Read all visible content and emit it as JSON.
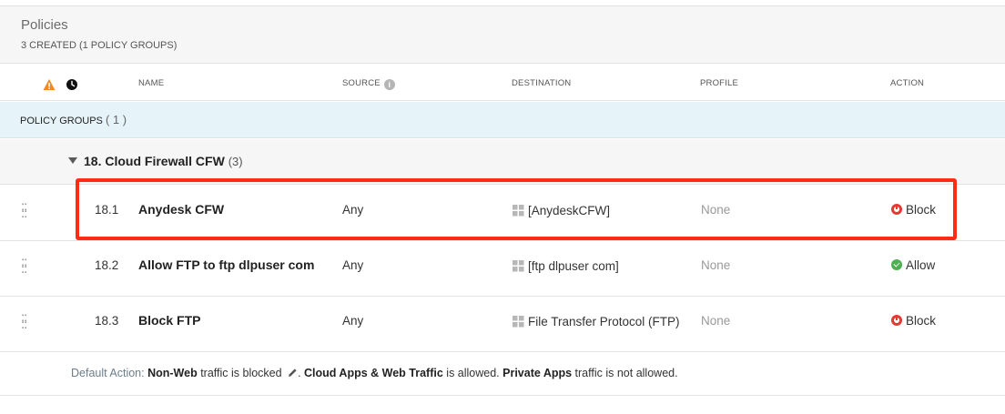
{
  "header": {
    "title": "Policies",
    "subtitle": "3 CREATED (1 POLICY GROUPS)"
  },
  "columns": {
    "warning_icon": "warning-icon",
    "clock_icon": "clock-icon",
    "name": "NAME",
    "source": "SOURCE",
    "destination": "DESTINATION",
    "profile": "PROFILE",
    "action": "ACTION"
  },
  "policy_groups": {
    "label": "POLICY GROUPS",
    "count": "( 1 )"
  },
  "group": {
    "name": "18. Cloud Firewall CFW",
    "count": "(3)"
  },
  "rules": [
    {
      "num": "18.1",
      "name": "Anydesk CFW",
      "source": "Any",
      "destination": "[AnydeskCFW]",
      "profile": "None",
      "action": "Block",
      "action_icon": "block-icon",
      "highlighted": true
    },
    {
      "num": "18.2",
      "name": "Allow FTP to ftp dlpuser com",
      "source": "Any",
      "destination": "[ftp dlpuser com]",
      "profile": "None",
      "action": "Allow",
      "action_icon": "allow-icon",
      "highlighted": false
    },
    {
      "num": "18.3",
      "name": "Block FTP",
      "source": "Any",
      "destination": "File Transfer Protocol (FTP)",
      "profile": "None",
      "action": "Block",
      "action_icon": "block-icon",
      "highlighted": false
    }
  ],
  "footer": {
    "label": "Default Action:",
    "nonweb": "Non-Web",
    "nonweb_text": " traffic is blocked ",
    "cloud": "Cloud Apps & Web Traffic",
    "cloud_text": " is allowed. ",
    "private": "Private Apps",
    "private_text": " traffic is not allowed."
  },
  "colors": {
    "highlight": "#ff2b17",
    "block": "#e53935",
    "allow": "#4caf50",
    "groups_bar": "#e6f4f9"
  }
}
